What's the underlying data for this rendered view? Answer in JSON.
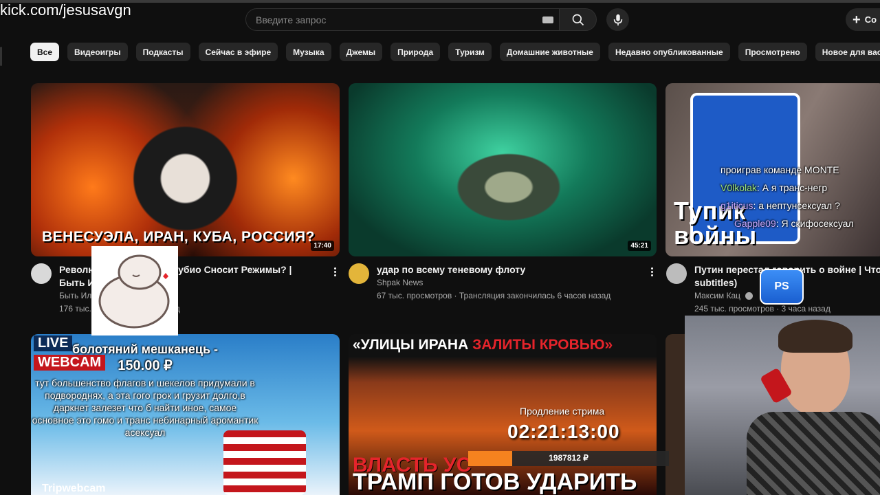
{
  "watermark": "kick.com/jesusavgn",
  "search": {
    "placeholder": "Введите запрос"
  },
  "header": {
    "create_label": "Со"
  },
  "chips": [
    "Все",
    "Видеоигры",
    "Подкасты",
    "Сейчас в эфире",
    "Музыка",
    "Джемы",
    "Природа",
    "Туризм",
    "Домашние животные",
    "Недавно опубликованные",
    "Просмотрено",
    "Новое для вас"
  ],
  "videos": [
    {
      "thumb_text": "ВЕНЕСУЭЛА, ИРАН, КУБА, РОССИЯ?",
      "duration": "17:40",
      "title": "Револю                   арко Рубио Сносит Режимы? |",
      "title2": "Быть И",
      "channel": "Быть Ил",
      "meta": "176 тыс.                             назад"
    },
    {
      "thumb_text": "",
      "duration": "45:21",
      "title": "удар по всему теневому флоту",
      "channel": "Shpak News",
      "meta": "67 тыс. просмотров · Трансляция закончилась 6 часов назад"
    },
    {
      "thumb_text": "Тупик войны",
      "duration": "",
      "title": "Путин перестал говорить о войне | Что слу",
      "title2": "subtitles)",
      "channel": "Максим Кац",
      "meta": "245 тыс. просмотров · 3 часа назад"
    }
  ],
  "row2": {
    "card1_badges": [
      "LIVE",
      "WEBCAM"
    ],
    "card1_text": "Tripwebcam",
    "card2_top": "«УЛИЦЫ ИРАНА ЗАЛИТЫ КРОВЬЮ»",
    "card2_top_white": "«УЛИЦЫ ИРАНА ",
    "card2_top_red": "ЗАЛИТЫ КРОВЬЮ»",
    "card2_bottom1": "ВЛАСТЬ УС",
    "card2_bottom2": "ТРАМП ГОТОВ УДАРИТЬ"
  },
  "chat": [
    {
      "user": "",
      "text": "проиграв команде MONTE",
      "color": "#ffffff"
    },
    {
      "user": "V0lkolak",
      "text": ": А я транс-негр",
      "color": "#9be37a"
    },
    {
      "user": "g1iticus",
      "text": ": а нептунсексуал ?",
      "color": "#c9a8ff"
    },
    {
      "user": "Gapple09",
      "text": ": Я скифосексуал",
      "color": "#c9a8ff"
    }
  ],
  "donation": {
    "name": "болотяний мешканець -",
    "amount": "150.00 ₽",
    "message": "тут большенство флагов и шекелов придумали в подвороднях, а эта гого грок и грузит долго,в даркнет залезет что б найти иное, самое основное это гомо и транс небинарный аромантик асексуал"
  },
  "stream_timer": {
    "label": "Продление стрима",
    "value": "02:21:13:00"
  },
  "goal": {
    "text": "1987812 ₽",
    "progress": 0.22
  },
  "badge": "PS",
  "colors": {
    "bg": "#0f0f0f",
    "chip": "#272727",
    "accent": "#f5821f"
  }
}
